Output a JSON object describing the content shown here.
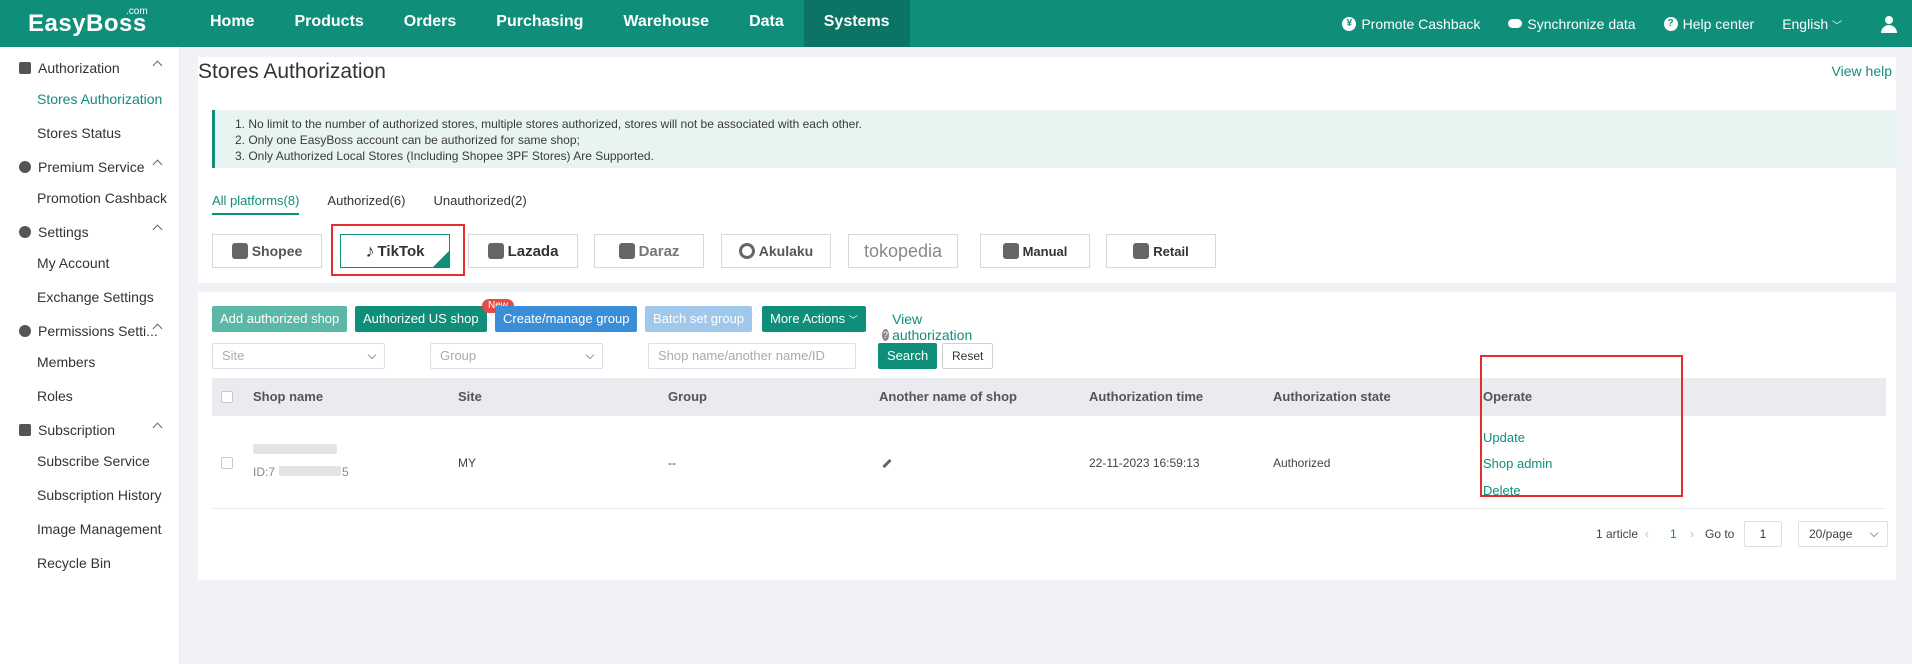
{
  "header": {
    "logo": "EasyBoss",
    "logo_suffix": ".com",
    "nav": [
      "Home",
      "Products",
      "Orders",
      "Purchasing",
      "Warehouse",
      "Data",
      "Systems"
    ],
    "active_nav": "Systems",
    "promote": "Promote Cashback",
    "sync": "Synchronize data",
    "help": "Help center",
    "language": "English"
  },
  "sidebar": {
    "groups": [
      {
        "label": "Authorization",
        "icon": "authorization-icon",
        "items": [
          "Stores Authorization",
          "Stores Status"
        ]
      },
      {
        "label": "Premium Service",
        "icon": "premium-icon",
        "items": [
          "Promotion Cashback"
        ]
      },
      {
        "label": "Settings",
        "icon": "gear-icon",
        "items": [
          "My Account",
          "Exchange Settings"
        ]
      },
      {
        "label": "Permissions Setti...",
        "icon": "user-icon",
        "items": [
          "Members",
          "Roles"
        ]
      },
      {
        "label": "Subscription",
        "icon": "subscription-icon",
        "items": [
          "Subscribe Service",
          "Subscription History",
          "Image Management",
          "Recycle Bin"
        ]
      }
    ],
    "active_item": "Stores Authorization"
  },
  "page": {
    "title": "Stores Authorization",
    "view_help": "View help",
    "notice": [
      "1. No limit to the number of authorized stores, multiple stores authorized, stores will not be associated with each other.",
      "2. Only one EasyBoss account can be authorized for same shop;",
      "3. Only Authorized Local Stores (Including Shopee 3PF Stores) Are Supported."
    ],
    "tabs": [
      "All platforms(8)",
      "Authorized(6)",
      "Unauthorized(2)"
    ],
    "active_tab": "All platforms(8)",
    "platforms": [
      "Shopee",
      "TikTok",
      "Lazada",
      "Daraz",
      "Akulaku",
      "tokopedia",
      "Manual",
      "Retail"
    ],
    "selected_platform": "TikTok"
  },
  "toolbar": {
    "add": "Add authorized shop",
    "us": "Authorized US shop",
    "new_badge": "New",
    "group": "Create/manage group",
    "batch": "Batch set group",
    "more": "More Actions",
    "help": "View authorization help"
  },
  "filters": {
    "site_placeholder": "Site",
    "group_placeholder": "Group",
    "search_placeholder": "Shop name/another name/ID",
    "search": "Search",
    "reset": "Reset"
  },
  "table": {
    "columns": [
      "Shop name",
      "Site",
      "Group",
      "Another name of shop",
      "Authorization time",
      "Authorization state",
      "Operate"
    ],
    "rows": [
      {
        "id_prefix": "ID:7",
        "id_suffix": "5",
        "site": "MY",
        "group": "--",
        "time": "22-11-2023 16:59:13",
        "state": "Authorized",
        "ops": [
          "Update",
          "Shop admin",
          "Delete"
        ]
      }
    ]
  },
  "pagination": {
    "total": "1 article",
    "page": "1",
    "goto_label": "Go to",
    "goto_value": "1",
    "page_size": "20/page"
  },
  "colors": {
    "brand": "#0f8e7a",
    "highlight": "#e52d2d"
  }
}
